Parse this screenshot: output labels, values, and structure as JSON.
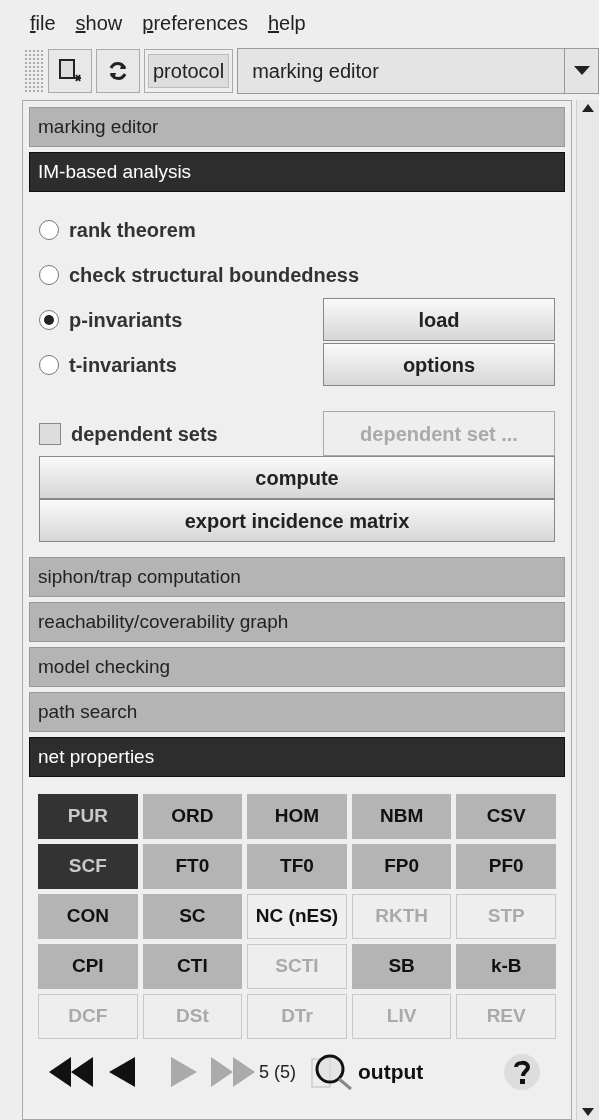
{
  "menu": [
    {
      "label": "file",
      "mnemonic_underlined": true
    },
    {
      "label": "show",
      "mnemonic_underlined": true
    },
    {
      "label": "preferences",
      "mnemonic_underlined": true
    },
    {
      "label": "help",
      "mnemonic_underlined": true
    }
  ],
  "toolbar": {
    "protocol_button": "protocol",
    "view_select": "marking editor"
  },
  "sections_top": [
    {
      "title": "marking editor",
      "expanded": false
    },
    {
      "title": "IM-based analysis",
      "expanded": true
    }
  ],
  "analysis": {
    "options": [
      {
        "label": "rank theorem",
        "selected": false
      },
      {
        "label": "check structural boundedness",
        "selected": false
      },
      {
        "label": "p-invariants",
        "selected": true
      },
      {
        "label": "t-invariants",
        "selected": false
      }
    ],
    "side_buttons": [
      "load",
      "options"
    ],
    "dependent_sets": {
      "label": "dependent sets",
      "checked": false
    },
    "dependent_set_button": {
      "label": "dependent set ...",
      "disabled": true
    },
    "actions": [
      "compute",
      "export incidence matrix"
    ]
  },
  "sections_bottom": [
    {
      "title": "siphon/trap computation",
      "expanded": false
    },
    {
      "title": "reachability/coverability graph",
      "expanded": false
    },
    {
      "title": "model checking",
      "expanded": false
    },
    {
      "title": "path search",
      "expanded": false
    },
    {
      "title": "net properties",
      "expanded": true
    }
  ],
  "properties": [
    {
      "label": "PUR",
      "kind": "yes"
    },
    {
      "label": "ORD",
      "kind": "no"
    },
    {
      "label": "HOM",
      "kind": "no"
    },
    {
      "label": "NBM",
      "kind": "no"
    },
    {
      "label": "CSV",
      "kind": "no"
    },
    {
      "label": "SCF",
      "kind": "yes"
    },
    {
      "label": "FT0",
      "kind": "no"
    },
    {
      "label": "TF0",
      "kind": "no"
    },
    {
      "label": "FP0",
      "kind": "no"
    },
    {
      "label": "PF0",
      "kind": "no"
    },
    {
      "label": "CON",
      "kind": "no"
    },
    {
      "label": "SC",
      "kind": "no"
    },
    {
      "label": "NC (nES)",
      "kind": "unknown"
    },
    {
      "label": "RKTH",
      "kind": "disabled"
    },
    {
      "label": "STP",
      "kind": "disabled"
    },
    {
      "label": "CPI",
      "kind": "no"
    },
    {
      "label": "CTI",
      "kind": "no"
    },
    {
      "label": "SCTI",
      "kind": "disabled"
    },
    {
      "label": "SB",
      "kind": "no"
    },
    {
      "label": "k-B",
      "kind": "no"
    },
    {
      "label": "DCF",
      "kind": "disabled"
    },
    {
      "label": "DSt",
      "kind": "disabled"
    },
    {
      "label": "DTr",
      "kind": "disabled"
    },
    {
      "label": "LIV",
      "kind": "disabled"
    },
    {
      "label": "REV",
      "kind": "disabled"
    }
  ],
  "navigation": {
    "first_disabled": false,
    "prev_disabled": false,
    "next_disabled": true,
    "last_disabled": true,
    "counter": "5 (5)",
    "output_button": "output"
  }
}
